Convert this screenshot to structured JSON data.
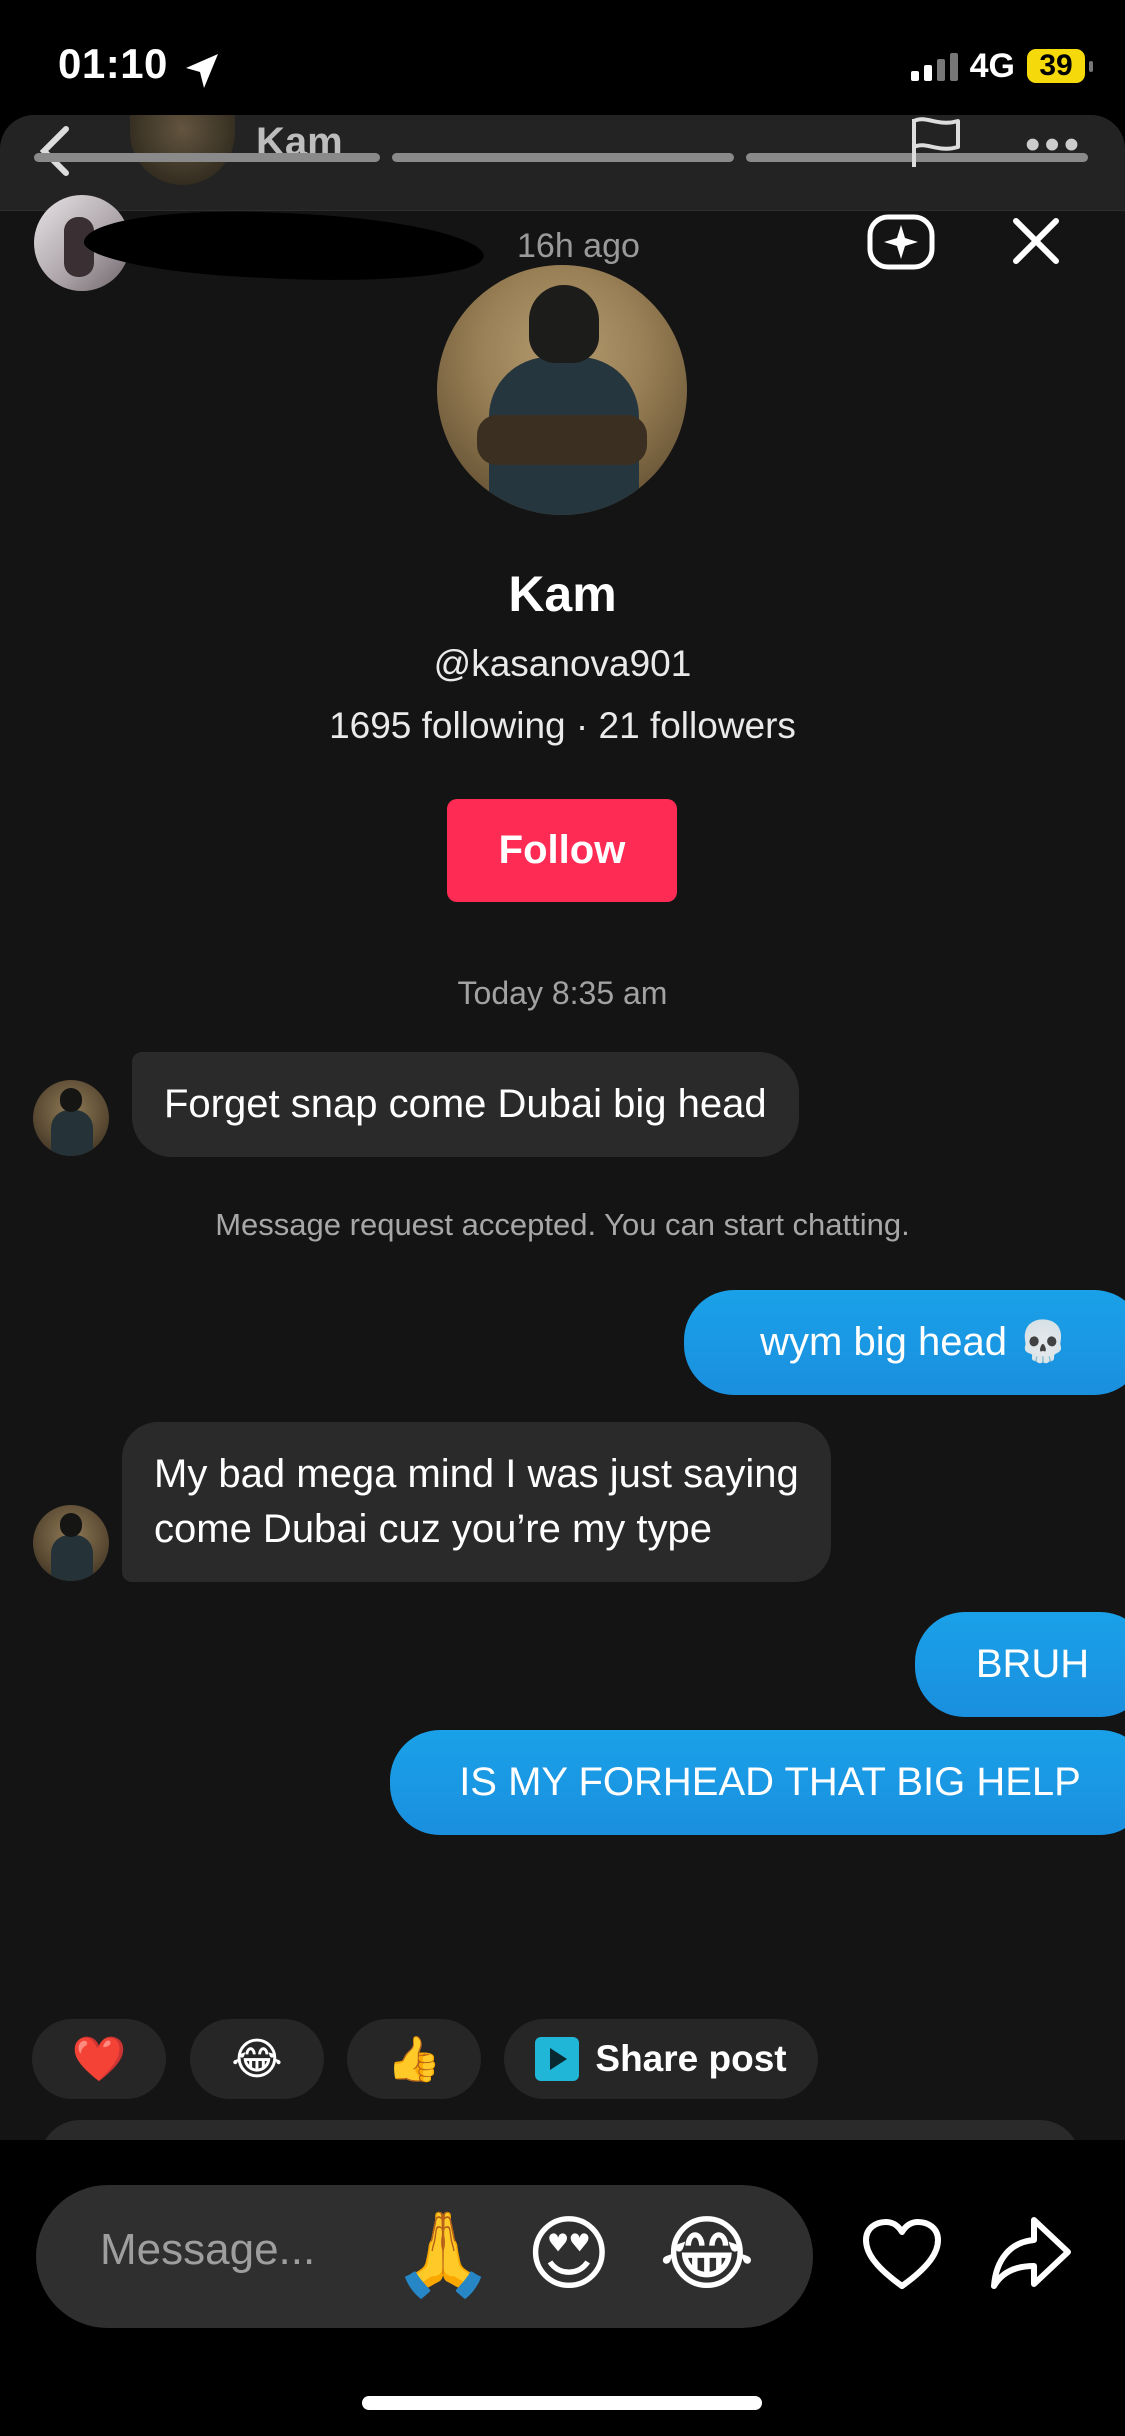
{
  "status_bar": {
    "time": "01:10",
    "network": "4G",
    "battery": "39"
  },
  "story": {
    "header_name": "Kam",
    "posted_ago": "16h ago",
    "progress_segments": 3
  },
  "profile": {
    "name": "Kam",
    "handle": "@kasanova901",
    "stats": "1695 following · 21 followers",
    "follow_label": "Follow"
  },
  "chat": {
    "date_separator": "Today 8:35 am",
    "messages": [
      {
        "from": "them",
        "text": "Forget snap come Dubai big head"
      },
      {
        "from": "system",
        "text": "Message request accepted. You can start chatting."
      },
      {
        "from": "me",
        "text": "wym big head 💀"
      },
      {
        "from": "them",
        "lines": [
          "My bad mega mind I was just saying",
          "come Dubai cuz you’re my type"
        ]
      },
      {
        "from": "me",
        "text": "BRUH"
      },
      {
        "from": "me",
        "text": "IS MY FORHEAD THAT BIG HELP"
      }
    ]
  },
  "quick_reactions": [
    "❤️",
    "😂",
    "👍"
  ],
  "share_post_label": "Share post",
  "composer": {
    "placeholder": "Message...",
    "emojis": [
      "🙏",
      "😍",
      "😂"
    ]
  },
  "icons": {
    "back": "chevron-left-icon",
    "flag": "flag-icon",
    "more": "more-dots-icon",
    "sparkle": "sparkle-icon",
    "close": "close-icon",
    "heart": "heart-icon",
    "share": "share-arrow-icon"
  },
  "colors": {
    "follow": "#fe2c55",
    "outgoing_bubble": "#1a96e3",
    "battery": "#f5d90a"
  }
}
